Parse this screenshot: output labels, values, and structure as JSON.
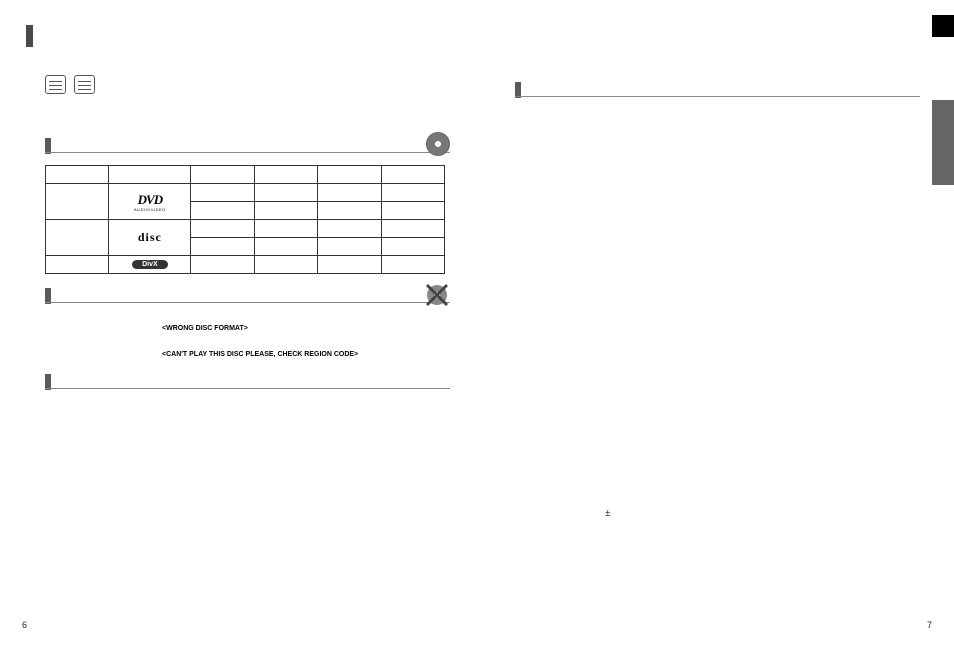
{
  "page_numbers": {
    "left": "6",
    "right": "7"
  },
  "top_icons": [
    "keyboard-icon",
    "keyboard-icon"
  ],
  "sections": {
    "playable_heading": "",
    "not_playable_heading": "",
    "disc_handling_heading": "",
    "right_heading": ""
  },
  "disc_table": {
    "headers": [
      "",
      "",
      "",
      "",
      "",
      ""
    ],
    "rows": [
      {
        "logo": "DVD",
        "logo_sub": "AUDIO/VIDEO",
        "cells": [
          "",
          "",
          "",
          "",
          ""
        ]
      },
      {
        "logo_row2_cells": [
          "",
          "",
          "",
          ""
        ]
      },
      {
        "logo": "disc",
        "cells": [
          "",
          "",
          "",
          "",
          ""
        ]
      },
      {
        "logo_row4_cells": [
          "",
          "",
          "",
          ""
        ]
      },
      {
        "logo": "DivX",
        "cells": [
          "",
          "",
          "",
          "",
          ""
        ]
      }
    ]
  },
  "error_messages": {
    "wrong_format": "<WRONG DISC FORMAT>",
    "region_code": "<CAN'T PLAY THIS DISC PLEASE, CHECK REGION CODE>"
  },
  "symbols": {
    "plus_minus": "±"
  }
}
